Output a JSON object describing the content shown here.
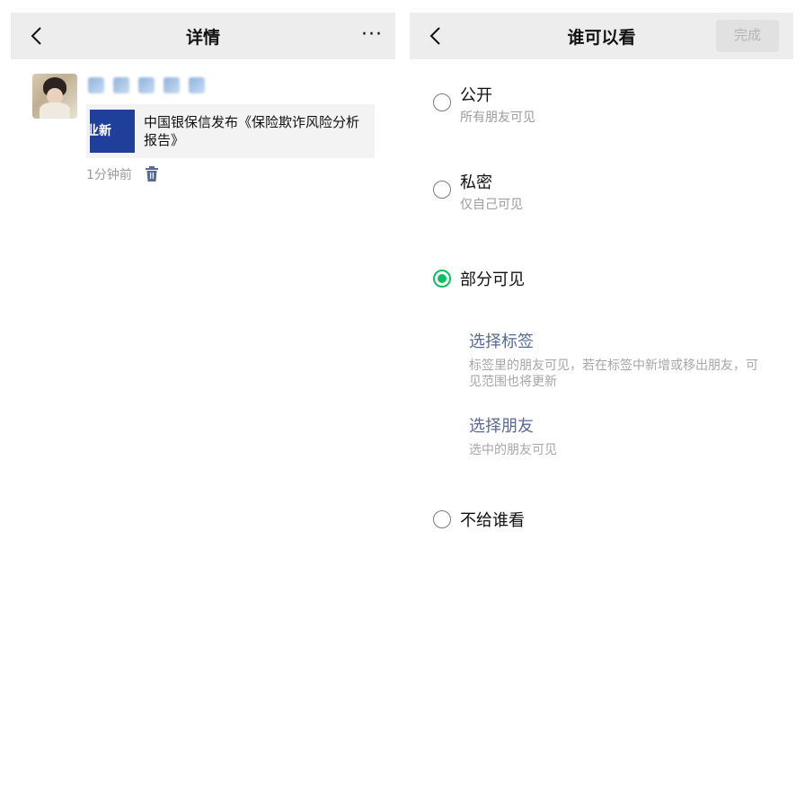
{
  "left": {
    "header": {
      "title": "详情",
      "more": "···"
    },
    "post": {
      "link": {
        "thumb_text": "业新",
        "title": "中国银保信发布《保险欺诈风险分析报告》"
      },
      "time": "1分钟前"
    }
  },
  "right": {
    "header": {
      "title": "谁可以看",
      "done_label": "完成"
    },
    "options": [
      {
        "title": "公开",
        "desc": "所有朋友可见",
        "selected": false
      },
      {
        "title": "私密",
        "desc": "仅自己可见",
        "selected": false
      },
      {
        "title": "部分可见",
        "desc": "",
        "selected": true
      },
      {
        "title": "不给谁看",
        "desc": "",
        "selected": false
      }
    ],
    "partial": {
      "tags": {
        "title": "选择标签",
        "desc": "标签里的朋友可见，若在标签中新增或移出朋友，可见范围也将更新"
      },
      "friends": {
        "title": "选择朋友",
        "desc": "选中的朋友可见"
      }
    }
  },
  "colors": {
    "accent": "#07c160",
    "link": "#576b95",
    "navbar": "#ededed",
    "gray_text": "#9b9b9b"
  }
}
